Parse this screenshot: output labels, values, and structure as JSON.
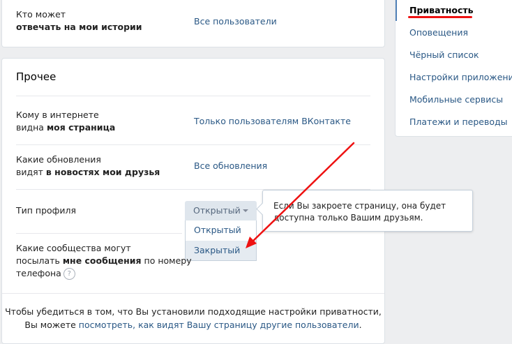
{
  "settings": {
    "stories_reply": {
      "label_line1": "Кто может",
      "label_line2": "отвечать на мои истории",
      "value": "Все пользователи"
    },
    "other_section": {
      "title": "Прочее",
      "page_visibility": {
        "label_line1": "Кому в интернете",
        "label_line2_plain": "видна ",
        "label_line2_bold": "моя страница",
        "value": "Только пользователям ВКонтакте"
      },
      "friends_news": {
        "label_line1": "Какие обновления",
        "label_line2_plain": "видят ",
        "label_line2_bold": "в новостях мои друзья",
        "value": "Все обновления"
      },
      "profile_type": {
        "label": "Тип профиля",
        "selected": "Открытый",
        "options": [
          "Открытый",
          "Закрытый"
        ]
      },
      "phone_messages": {
        "label_line1": "Какие сообщества могут",
        "label_line2_plain": "посылать ",
        "label_line2_bold": "мне сообщения",
        "label_line2_tail": " по номеру",
        "label_line3": "телефона",
        "help_icon": "question-icon",
        "help_glyph": "?"
      }
    },
    "footer": {
      "line1": "Чтобы убедиться в том, что Вы установили подходящие настройки приватности,",
      "line2_prefix": "Вы можете ",
      "link1": "посмотреть",
      "link2": ", как видят Вашу страницу другие пользователи",
      "line2_suffix": "."
    },
    "tooltip": {
      "text": "Если Вы закроете страницу, она будет доступна только Вашим друзьям."
    }
  },
  "right_menu": {
    "items": [
      {
        "label": "Приватность",
        "active": true
      },
      {
        "label": "Оповещения"
      },
      {
        "label": "Чёрный список"
      },
      {
        "label": "Настройки приложений"
      },
      {
        "label": "Мобильные сервисы"
      },
      {
        "label": "Платежи и переводы"
      }
    ]
  },
  "colors": {
    "link": "#2a5885",
    "annotation": "#ee1111",
    "background": "#edeef0"
  }
}
